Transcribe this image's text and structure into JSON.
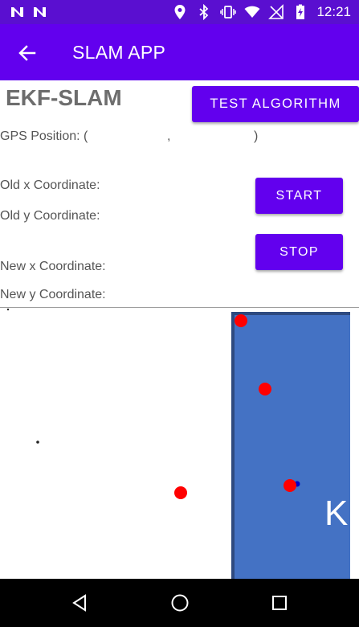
{
  "status_bar": {
    "time": "12:21",
    "left_icons": [
      "notification-n-icon",
      "notification-n-icon"
    ],
    "right_icons": [
      "location-icon",
      "bluetooth-icon",
      "vibrate-icon",
      "wifi-icon",
      "no-signal-icon",
      "battery-charging-icon"
    ]
  },
  "app_bar": {
    "title": "SLAM APP",
    "back_icon": "arrow-back-icon",
    "color": "#6200ee"
  },
  "main": {
    "heading": "EKF-SLAM",
    "test_button": "TEST ALGORITHM",
    "gps_label": "GPS Position: (",
    "gps_comma": ",",
    "gps_close": ")",
    "old_x_label": "Old x Coordinate:",
    "old_y_label": "Old y Coordinate:",
    "new_x_label": "New x Coordinate:",
    "new_y_label": "New y Coordinate:",
    "start_button": "START",
    "stop_button": "STOP"
  },
  "map": {
    "building_label": "K",
    "building_color": "#4472c4",
    "landmark_color": "#ff0000",
    "robot_color": "#0000cc"
  },
  "nav_bar": {
    "icons": [
      "back-triangle-icon",
      "home-circle-icon",
      "recents-square-icon"
    ]
  }
}
